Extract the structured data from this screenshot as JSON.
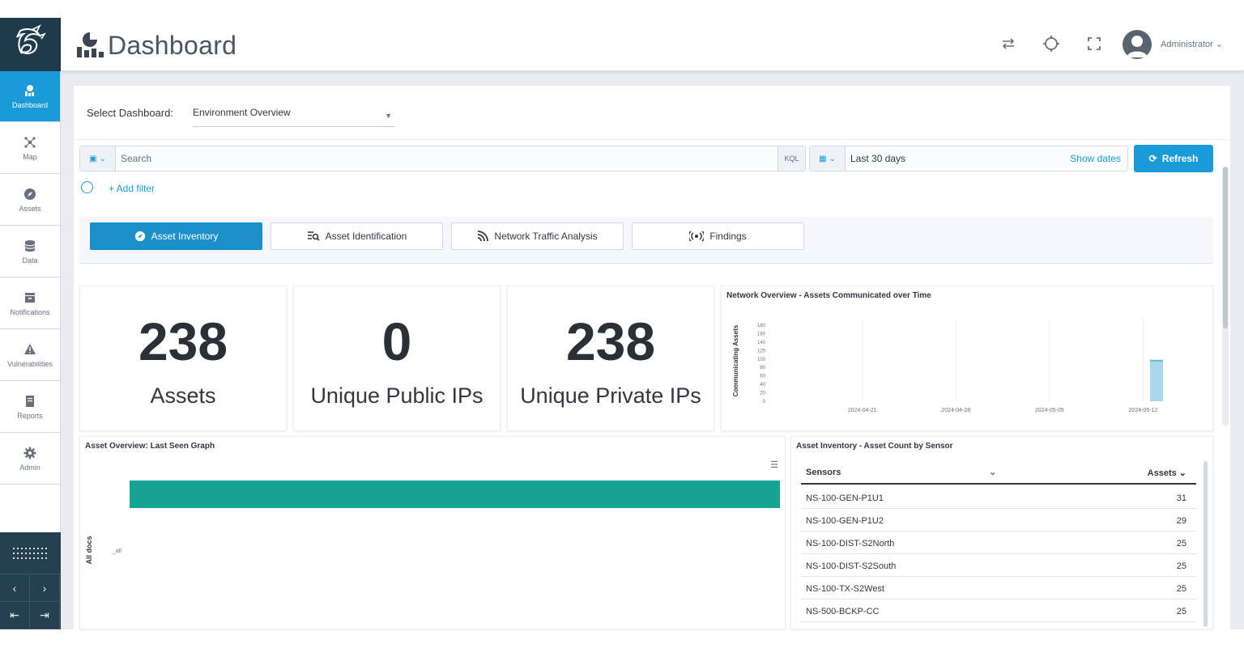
{
  "header": {
    "title": "Dashboard",
    "user": "Administrator"
  },
  "sidebar": {
    "items": [
      {
        "label": "Dashboard",
        "icon": "dashboard-icon"
      },
      {
        "label": "Map",
        "icon": "map-icon"
      },
      {
        "label": "Assets",
        "icon": "assets-icon"
      },
      {
        "label": "Data",
        "icon": "data-icon"
      },
      {
        "label": "Notifications",
        "icon": "notifications-icon"
      },
      {
        "label": "Vulnerabilities",
        "icon": "vulnerabilities-icon"
      },
      {
        "label": "Reports",
        "icon": "reports-icon"
      },
      {
        "label": "Admin",
        "icon": "admin-icon"
      }
    ]
  },
  "toolbar": {
    "select_label": "Select Dashboard:",
    "select_value": "Environment Overview",
    "search_placeholder": "Search",
    "kql": "KQL",
    "date_range": "Last 30 days",
    "show_dates": "Show dates",
    "refresh": "Refresh",
    "add_filter": "+ Add filter"
  },
  "tabs": [
    {
      "label": "Asset Inventory",
      "active": true
    },
    {
      "label": "Asset Identification",
      "active": false
    },
    {
      "label": "Network Traffic Analysis",
      "active": false
    },
    {
      "label": "Findings",
      "active": false
    }
  ],
  "stats": [
    {
      "value": "238",
      "label": "Assets"
    },
    {
      "value": "0",
      "label": "Unique Public IPs"
    },
    {
      "value": "238",
      "label": "Unique Private IPs"
    }
  ],
  "network_chart": {
    "title": "Network Overview - Assets Communicated over Time",
    "ylabel": "Communicating Assets",
    "ticks": [
      "180",
      "160",
      "140",
      "120",
      "100",
      "80",
      "60",
      "40",
      "20",
      "0"
    ],
    "xticks": [
      "2024-04-21",
      "2024-04-28",
      "2024-05-05",
      "2024-05-12"
    ]
  },
  "last_seen": {
    "title": "Asset Overview: Last Seen Graph",
    "ylabel": "All docs",
    "bar_label": "_all"
  },
  "sensor_table": {
    "title": "Asset Inventory - Asset Count by Sensor",
    "col_sensors": "Sensors",
    "col_assets": "Assets",
    "rows": [
      {
        "sensor": "NS-100-GEN-P1U1",
        "assets": "31"
      },
      {
        "sensor": "NS-100-GEN-P1U2",
        "assets": "29"
      },
      {
        "sensor": "NS-100-DIST-S2North",
        "assets": "25"
      },
      {
        "sensor": "NS-100-DIST-S2South",
        "assets": "25"
      },
      {
        "sensor": "NS-100-TX-S2West",
        "assets": "25"
      },
      {
        "sensor": "NS-500-BCKP-CC",
        "assets": "25"
      }
    ]
  },
  "chart_data": [
    {
      "type": "bar",
      "title": "Network Overview - Assets Communicated over Time",
      "xlabel": "",
      "ylabel": "Communicating Assets",
      "ylim": [
        0,
        180
      ],
      "x_ticks": [
        "2024-04-21",
        "2024-04-28",
        "2024-05-05",
        "2024-05-12"
      ],
      "series": [
        {
          "x": [
            "2024-05-13"
          ],
          "values": [
            98
          ]
        }
      ]
    },
    {
      "type": "bar",
      "title": "Asset Overview: Last Seen Graph",
      "ylabel": "All docs",
      "categories": [
        "_all"
      ],
      "values": [
        238
      ]
    }
  ],
  "colors": {
    "accent": "#1a9bd7",
    "sidebar_dark": "#1e3a4b",
    "bar_teal": "#16a394",
    "bar_light_blue": "#a8d8ea"
  }
}
